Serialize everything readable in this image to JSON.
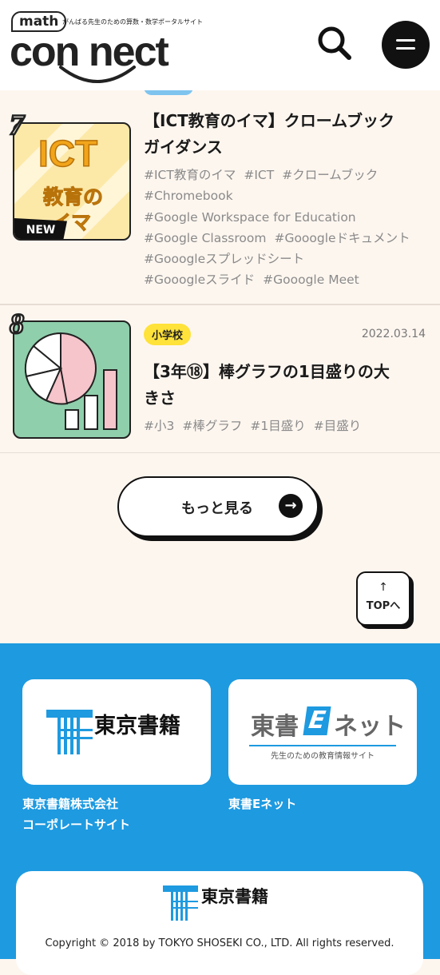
{
  "header": {
    "logo_math": "math",
    "logo_tagline": "がんばる先生のための算数・数学ポータルサイト",
    "logo_word": "con nect"
  },
  "articles": [
    {
      "rank": "7",
      "title_line1": "【ICT教育のイマ】クロームブック",
      "title_line2": "ガイダンス",
      "thumb_text1": "ICT",
      "thumb_text2": "教育の",
      "thumb_text3": "イマ",
      "new_badge": "NEW",
      "tags": [
        "#ICT教育のイマ",
        "#ICT",
        "#クロームブック",
        "#Chromebook",
        "#Google Workspace for Education",
        "#Google Classroom",
        "#Gooogleドキュメント",
        "#Gooogleスプレッドシート",
        "#Gooogleスライド",
        "#Gooogle Meet"
      ]
    },
    {
      "rank": "8",
      "badge": "小学校",
      "date": "2022.03.14",
      "title_line1": "【3年⑱】棒グラフの1目盛りの大",
      "title_line2": "きさ",
      "tags": [
        "#小3",
        "#棒グラフ",
        "#1目盛り",
        "#目盛り"
      ]
    }
  ],
  "more_button": "もっと見る",
  "top_button": {
    "arrow": "↑",
    "label": "TOPへ"
  },
  "footer": {
    "card1_logo": "東京書籍",
    "card1_label_line1": "東京書籍株式会社",
    "card1_label_line2": "コーポレートサイト",
    "card2_logo_a": "東書",
    "card2_logo_b": "ネット",
    "card2_logo_e": "E",
    "card2_sub": "先生のための教育情報サイト",
    "card2_label": "東書Eネット",
    "bottom_logo": "東京書籍",
    "copyright": "Copyright © 2018 by TOKYO SHOSEKI CO., LTD. All rights reserved."
  },
  "colors": {
    "footer_bg": "#1e9ae0",
    "badge_yellow": "#ffe23a",
    "page_bg": "#fdf6ef"
  }
}
